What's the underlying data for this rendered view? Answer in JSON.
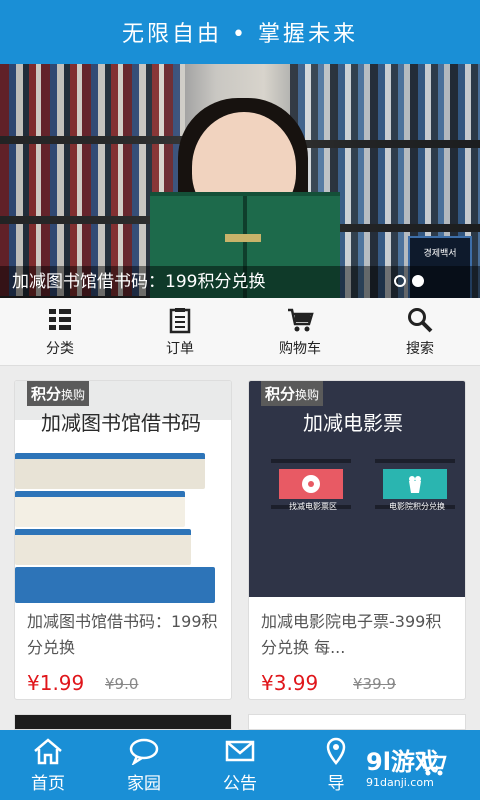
{
  "header": {
    "title": "无限自由 • 掌握未来"
  },
  "banner": {
    "caption": "加减图书馆借书码：199积分兑换",
    "book_text": "경제백서",
    "slides": 2,
    "active_slide": 2
  },
  "category_nav": [
    {
      "label": "分类",
      "icon": "grid-list-icon"
    },
    {
      "label": "订单",
      "icon": "clipboard-icon"
    },
    {
      "label": "购物车",
      "icon": "cart-icon"
    },
    {
      "label": "搜索",
      "icon": "search-icon"
    }
  ],
  "products": [
    {
      "badge_main": "积分",
      "badge_sub": "换购",
      "image_title": "加减图书馆借书码",
      "title": "加减图书馆借书码：199积分兑换",
      "price": "¥1.99",
      "old_price": "¥9.0"
    },
    {
      "badge_main": "积分",
      "badge_sub": "换购",
      "image_title": "加减电影票",
      "title": "加减电影院电子票-399积分兑换 每...",
      "price": "¥3.99",
      "old_price": "¥39.9",
      "film_left_label": "找减电影票区",
      "film_right_label": "电影院积分兑换"
    }
  ],
  "tabs": [
    {
      "label": "首页",
      "icon": "home-icon"
    },
    {
      "label": "家园",
      "icon": "chat-bubble-icon"
    },
    {
      "label": "公告",
      "icon": "envelope-icon"
    },
    {
      "label": "导",
      "icon": "location-pin-icon"
    },
    {
      "label": "",
      "icon": "cart-icon"
    }
  ],
  "watermark": {
    "main": "9l游戏",
    "sub": "91danji.com"
  },
  "colors": {
    "primary": "#1a8fd6",
    "price": "#e0161b",
    "badge": "#5a5a5a"
  }
}
